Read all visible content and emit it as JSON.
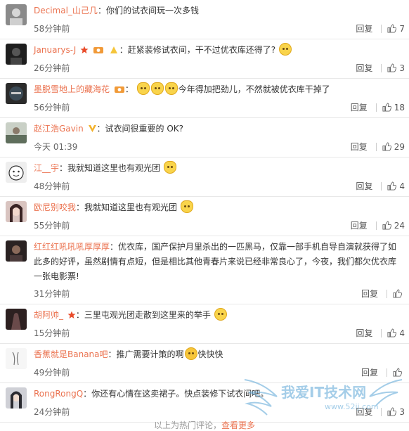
{
  "comments": [
    {
      "user": "Decimal_山己几",
      "text": "你们的试衣间玩一次多钱",
      "time": "58分钟前",
      "likes": "7",
      "avatar_color": "#7a7a7a"
    },
    {
      "user": "Januarys-J",
      "text": "赶紧装修试衣间，干不过优衣库还得了?",
      "time": "26分钟前",
      "likes": "3",
      "avatar_color": "#222222"
    },
    {
      "user": "墨脱雪地上的藏海花",
      "text": "今年得加把劲儿，不然就被优衣库干掉了",
      "time": "56分钟前",
      "likes": "18",
      "avatar_color": "#2b2b2b"
    },
    {
      "user": "赵江浩Gavin",
      "text": "试衣间很重要的 OK?",
      "time": "今天 01:39",
      "likes": "29",
      "avatar_color": "#6d7b6a"
    },
    {
      "user": "江__宇",
      "text": "我就知道这里也有观光团",
      "time": "48分钟前",
      "likes": "4",
      "avatar_color": "#dcdcdc"
    },
    {
      "user": "欧尼别咬我",
      "text": "我就知道这里也有观光团",
      "time": "55分钟前",
      "likes": "24",
      "avatar_color": "#9a6a6a"
    },
    {
      "user": "红红红吼吼吼厚厚厚",
      "text": "优衣库，国产保护月里杀出的一匹黑马，仅靠一部手机自导自演就获得了如此多的好评，虽然剧情有点短，但是相比其他青春片来说已经非常良心了，今夜，我们都欠优衣库一张电影票!",
      "time": "31分钟前",
      "likes": "",
      "avatar_color": "#3a2e2e"
    },
    {
      "user": "胡阿帅_",
      "text": "三里屯观光团走散到这里来的举手",
      "time": "15分钟前",
      "likes": "4",
      "avatar_color": "#2d2020"
    },
    {
      "user": "香蕉就是Banana吧",
      "text": "推广需要计策的啊",
      "text2": "快快快",
      "time": "49分钟前",
      "likes": "",
      "avatar_color": "#f0f0f0"
    },
    {
      "user": "RongRongQ",
      "text": "你还有心情在这卖裙子。快点装修下试衣间吧。",
      "time": "24分钟前",
      "likes": "3",
      "avatar_color": "#505058"
    }
  ],
  "labels": {
    "reply": "回复",
    "sep": "：",
    "more_prefix": "以上为热门评论，",
    "more_link": "查看更多"
  },
  "watermark": {
    "title": "我爱IT技术网",
    "url": "www.52ij.com"
  },
  "colors": {
    "username": "#eb7350"
  }
}
